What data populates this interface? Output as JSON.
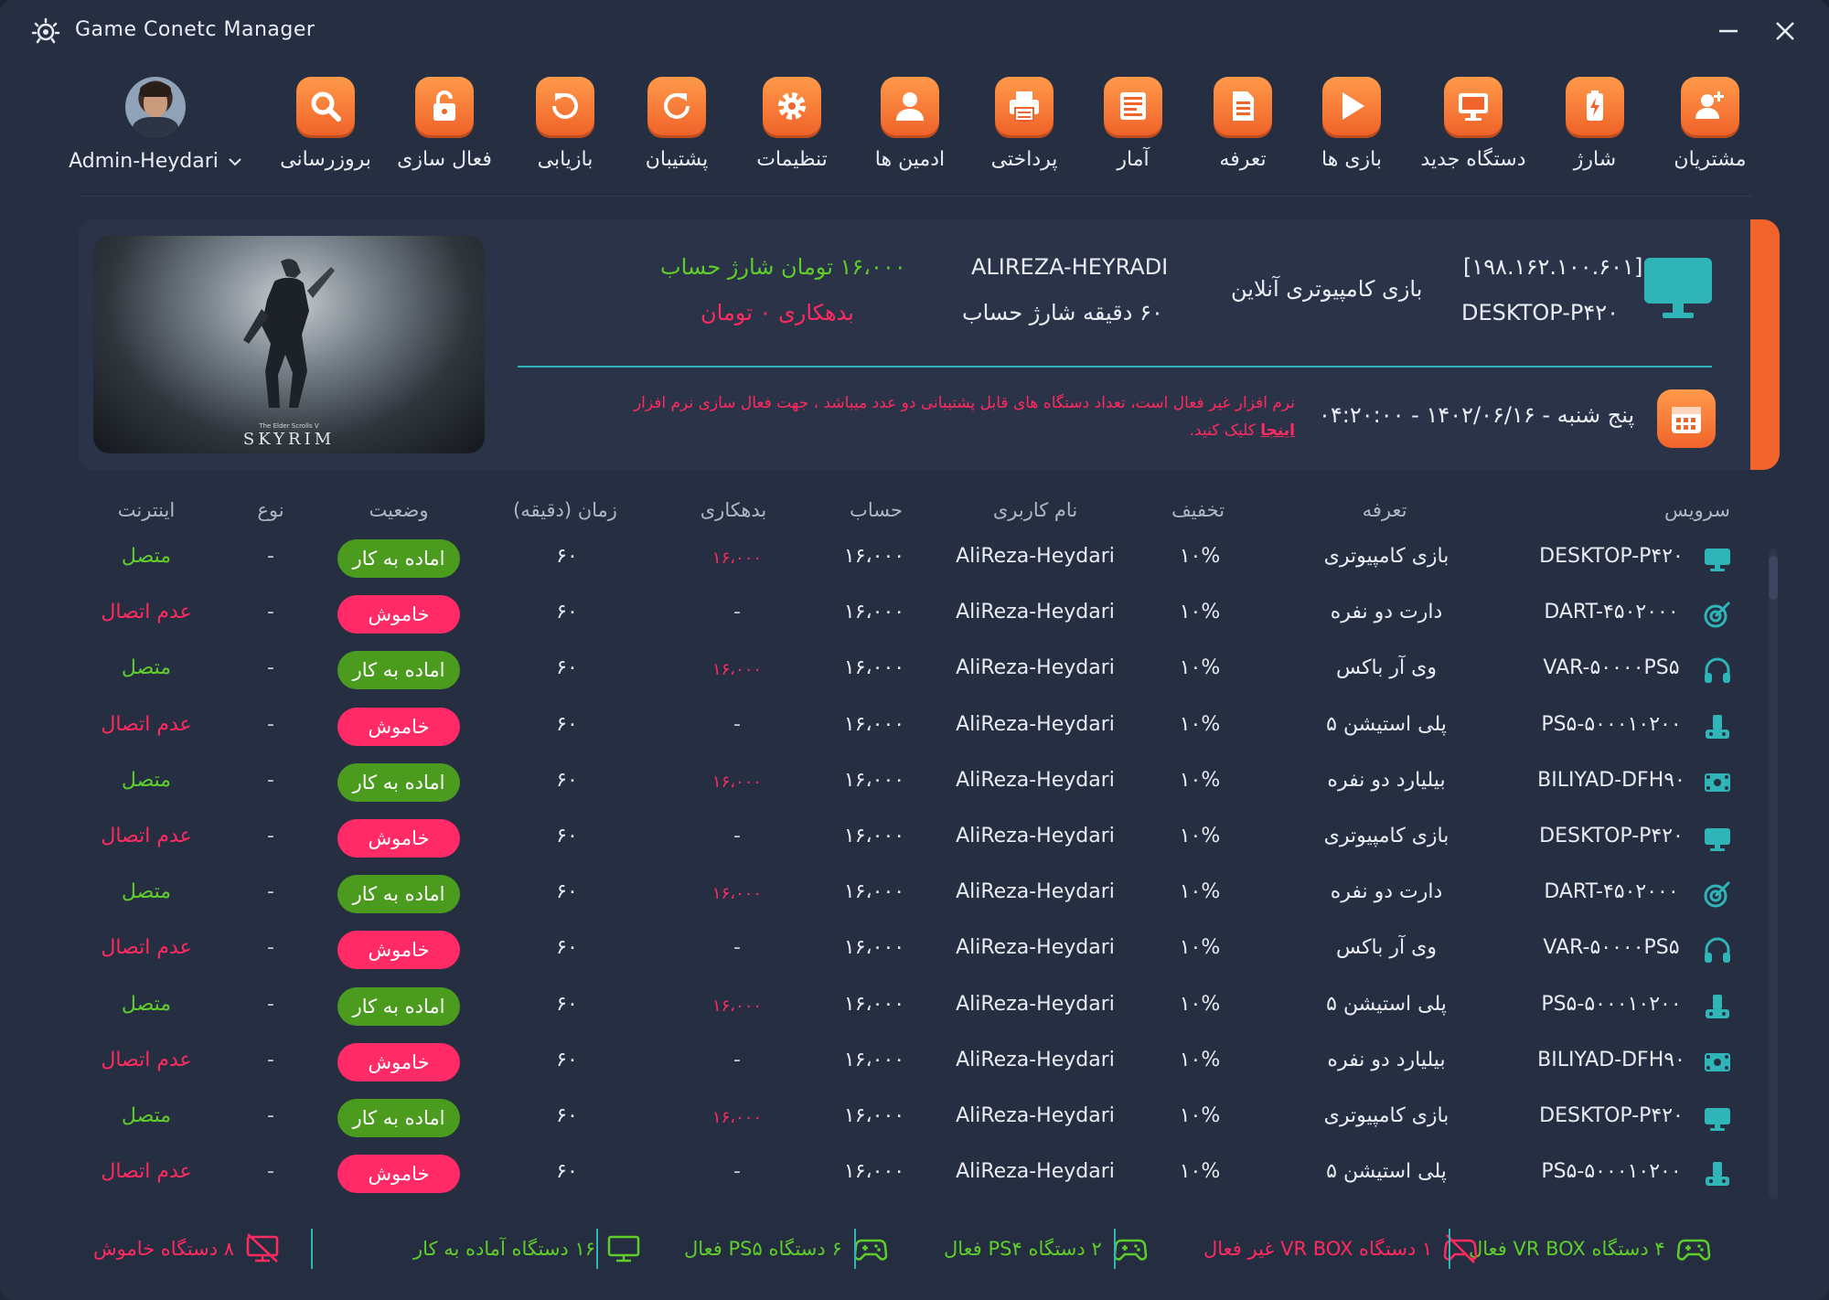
{
  "window": {
    "title": "Game Conetc Manager"
  },
  "toolbar": {
    "items": [
      {
        "label": "مشتریان",
        "icon": "add-user-icon"
      },
      {
        "label": "شارژ",
        "icon": "battery-icon"
      },
      {
        "label": "دستگاه جدید",
        "icon": "monitor-icon"
      },
      {
        "label": "بازی ها",
        "icon": "play-icon"
      },
      {
        "label": "تعرفه",
        "icon": "document-icon"
      },
      {
        "label": "آمار",
        "icon": "report-icon"
      },
      {
        "label": "پرداختی",
        "icon": "printer-icon"
      },
      {
        "label": "ادمین ها",
        "icon": "user-icon"
      },
      {
        "label": "تنظیمات",
        "icon": "gear-icon"
      },
      {
        "label": "پشتیبان",
        "icon": "backup-icon"
      },
      {
        "label": "بازیابی",
        "icon": "restore-icon"
      },
      {
        "label": "فعال سازی",
        "icon": "unlock-icon"
      },
      {
        "label": "بروزرسانی",
        "icon": "search-icon"
      }
    ],
    "admin": {
      "name": "Admin-Heydari"
    }
  },
  "info": {
    "ip": "[۱۹۸.۱۶۲.۱۰۰.۶۰۱]",
    "device": "DESKTOP-P۴۲۰",
    "category": "بازی کامپیوتری آنلاین",
    "user": "ALIREZA-HEYRADI",
    "minutes": "۶۰ دقیقه شارژ حساب",
    "balance": "۱۶،۰۰۰ تومان شارژ حساب",
    "debt": "بدهکاری ۰ تومان",
    "date": "پنج شنبه - ۱۴۰۲/۰۶/۱۶ - ۰۴:۲۰:۰۰",
    "warning": "نرم افزار غیر فعال است، تعداد دستگاه های قابل پشتیبانی دو عدد میباشد ، جهت فعال سازی نرم افزار",
    "warning_link": "اینجا",
    "warning_tail": "کلیک کنید.",
    "game": {
      "title": "SKYRIM",
      "subtitle": "The Elder Scrolls V"
    }
  },
  "table": {
    "headers": {
      "service": "سرویس",
      "tariff": "تعرفه",
      "discount": "تخفیف",
      "username": "نام کاربری",
      "account": "حساب",
      "debt": "بدهکاری",
      "time": "زمان (دقیقه)",
      "status": "وضعیت",
      "type": "نوع",
      "internet": "اینترنت"
    },
    "rows": [
      {
        "service": "DESKTOP-P۴۲۰",
        "icon": "monitor-icon",
        "tariff": "بازی کامپیوتری",
        "discount": "۱۰%",
        "username": "AliReza-Heydari",
        "account": "۱۶،۰۰۰",
        "debt": "۱۶،۰۰۰",
        "time": "۶۰",
        "status": "اماده به کار",
        "online": true,
        "type": "-",
        "internet": "متصل"
      },
      {
        "service": "DART-۴۵۰۲۰۰۰",
        "icon": "dart-icon",
        "tariff": "دارت دو نفره",
        "discount": "۱۰%",
        "username": "AliReza-Heydari",
        "account": "۱۶،۰۰۰",
        "debt": "-",
        "time": "۶۰",
        "status": "خاموش",
        "online": false,
        "type": "-",
        "internet": "عدم اتصال"
      },
      {
        "service": "VAR-۵۰۰۰۰PS۵",
        "icon": "headphones-icon",
        "tariff": "وی آر باکس",
        "discount": "۱۰%",
        "username": "AliReza-Heydari",
        "account": "۱۶،۰۰۰",
        "debt": "۱۶،۰۰۰",
        "time": "۶۰",
        "status": "اماده به کار",
        "online": true,
        "type": "-",
        "internet": "متصل"
      },
      {
        "service": "PS۵-۵۰۰۰۱۰۲۰۰",
        "icon": "console-icon",
        "tariff": "پلی استیشن ۵",
        "discount": "۱۰%",
        "username": "AliReza-Heydari",
        "account": "۱۶،۰۰۰",
        "debt": "-",
        "time": "۶۰",
        "status": "خاموش",
        "online": false,
        "type": "-",
        "internet": "عدم اتصال"
      },
      {
        "service": "BILIYAD-DFH۹۰",
        "icon": "billiard-icon",
        "tariff": "بیلیارد دو نفره",
        "discount": "۱۰%",
        "username": "AliReza-Heydari",
        "account": "۱۶،۰۰۰",
        "debt": "۱۶،۰۰۰",
        "time": "۶۰",
        "status": "اماده به کار",
        "online": true,
        "type": "-",
        "internet": "متصل"
      },
      {
        "service": "DESKTOP-P۴۲۰",
        "icon": "monitor-icon",
        "tariff": "بازی کامپیوتری",
        "discount": "۱۰%",
        "username": "AliReza-Heydari",
        "account": "۱۶،۰۰۰",
        "debt": "-",
        "time": "۶۰",
        "status": "خاموش",
        "online": false,
        "type": "-",
        "internet": "عدم اتصال"
      },
      {
        "service": "DART-۴۵۰۲۰۰۰",
        "icon": "dart-icon",
        "tariff": "دارت دو نفره",
        "discount": "۱۰%",
        "username": "AliReza-Heydari",
        "account": "۱۶،۰۰۰",
        "debt": "۱۶،۰۰۰",
        "time": "۶۰",
        "status": "اماده به کار",
        "online": true,
        "type": "-",
        "internet": "متصل"
      },
      {
        "service": "VAR-۵۰۰۰۰PS۵",
        "icon": "headphones-icon",
        "tariff": "وی آر باکس",
        "discount": "۱۰%",
        "username": "AliReza-Heydari",
        "account": "۱۶،۰۰۰",
        "debt": "-",
        "time": "۶۰",
        "status": "خاموش",
        "online": false,
        "type": "-",
        "internet": "عدم اتصال"
      },
      {
        "service": "PS۵-۵۰۰۰۱۰۲۰۰",
        "icon": "console-icon",
        "tariff": "پلی استیشن ۵",
        "discount": "۱۰%",
        "username": "AliReza-Heydari",
        "account": "۱۶،۰۰۰",
        "debt": "۱۶،۰۰۰",
        "time": "۶۰",
        "status": "اماده به کار",
        "online": true,
        "type": "-",
        "internet": "متصل"
      },
      {
        "service": "BILIYAD-DFH۹۰",
        "icon": "billiard-icon",
        "tariff": "بیلیارد دو نفره",
        "discount": "۱۰%",
        "username": "AliReza-Heydari",
        "account": "۱۶،۰۰۰",
        "debt": "-",
        "time": "۶۰",
        "status": "خاموش",
        "online": false,
        "type": "-",
        "internet": "عدم اتصال"
      },
      {
        "service": "DESKTOP-P۴۲۰",
        "icon": "monitor-icon",
        "tariff": "بازی کامپیوتری",
        "discount": "۱۰%",
        "username": "AliReza-Heydari",
        "account": "۱۶،۰۰۰",
        "debt": "۱۶،۰۰۰",
        "time": "۶۰",
        "status": "اماده به کار",
        "online": true,
        "type": "-",
        "internet": "متصل"
      },
      {
        "service": "PS۵-۵۰۰۰۱۰۲۰۰",
        "icon": "console-icon",
        "tariff": "پلی استیشن ۵",
        "discount": "۱۰%",
        "username": "AliReza-Heydari",
        "account": "۱۶،۰۰۰",
        "debt": "-",
        "time": "۶۰",
        "status": "خاموش",
        "online": false,
        "type": "-",
        "internet": "عدم اتصال"
      }
    ]
  },
  "footer": {
    "items": [
      {
        "text": "۴ دستگاه VR BOX فعال",
        "icon": "gamepad-icon",
        "tone": "green"
      },
      {
        "text": "۱ دستگاه VR BOX غیر فعال",
        "icon": "gamepad-off-icon",
        "tone": "red"
      },
      {
        "text": "۲ دستگاه PS۴ فعال",
        "icon": "gamepad-icon",
        "tone": "green"
      },
      {
        "text": "۶ دستگاه PS۵ فعال",
        "icon": "gamepad-icon",
        "tone": "green"
      },
      {
        "text": "۱۶ دستگاه آماده به کار",
        "icon": "monitor-icon",
        "tone": "green"
      },
      {
        "text": "۸ دستگاه خاموش",
        "icon": "monitor-off-icon",
        "tone": "red"
      }
    ]
  },
  "colors": {
    "accent": "#f0632a",
    "teal": "#2fb5b7",
    "green": "#5fce2a",
    "red": "#ff2a5f",
    "bg": "#262e42"
  }
}
